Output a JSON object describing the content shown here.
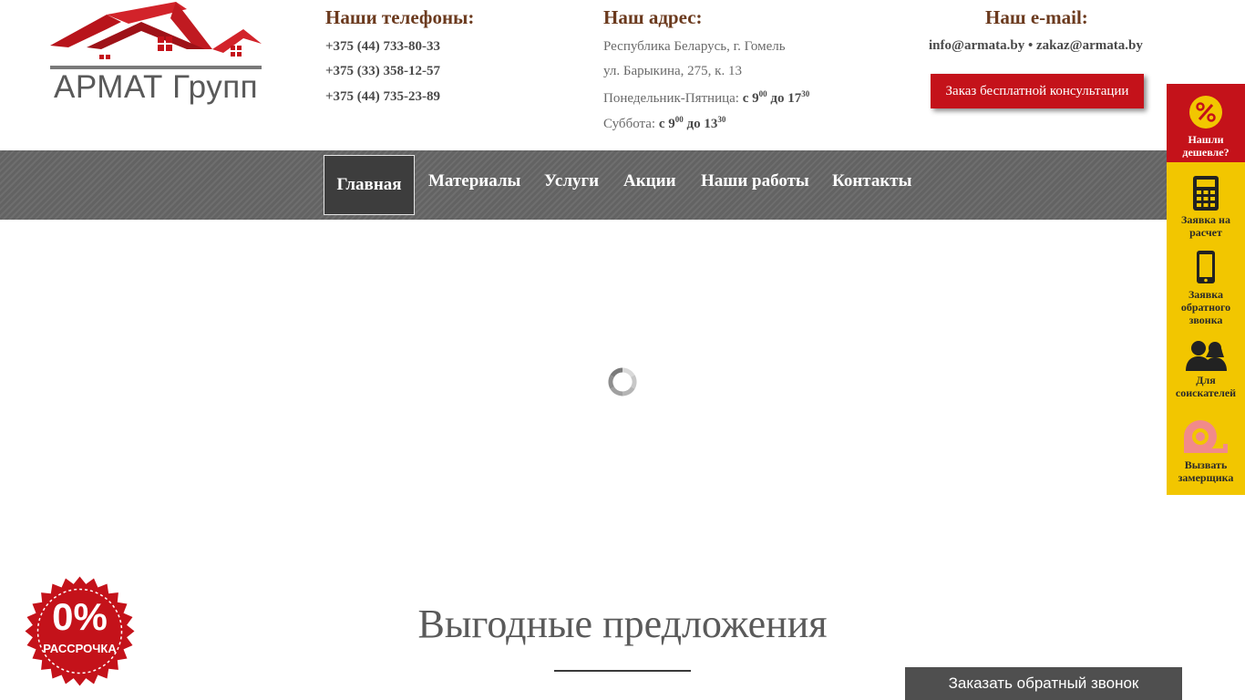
{
  "brand": {
    "logo_text": "АРМАТ Групп"
  },
  "contacts": {
    "phones_title": "Наши телефоны:",
    "phones": [
      "+375 (44) 733-80-33",
      "+375 (33) 358-12-57",
      "+375 (44) 735-23-89"
    ],
    "address_title": "Наш адрес:",
    "address_line1": "Республика Беларусь, г. Гомель",
    "address_line2": "ул. Барыкина, 275, к. 13",
    "weekdays_label": "Понедельник-Пятница:",
    "weekdays_from": "с 9",
    "weekdays_from_min": "00",
    "weekdays_to": "до 17",
    "weekdays_to_min": "30",
    "saturday_label": "Суббота:",
    "saturday_from": "с 9",
    "saturday_from_min": "00",
    "saturday_to": "до 13",
    "saturday_to_min": "30",
    "email_title": "Наш e-mail:",
    "email1": "info@armata.by",
    "email_sep": "•",
    "email2": "zakaz@armata.by",
    "consult_button": "Заказ бесплатной консультации"
  },
  "nav": {
    "items": [
      {
        "label": "Главная",
        "active": true
      },
      {
        "label": "Материалы"
      },
      {
        "label": "Услуги"
      },
      {
        "label": "Акции"
      },
      {
        "label": "Наши работы"
      },
      {
        "label": "Контакты"
      }
    ]
  },
  "sidebar": {
    "items": [
      {
        "label": "Нашли дешевле?",
        "icon": "percent-icon"
      },
      {
        "label": "Заявка на расчет",
        "icon": "calculator-icon"
      },
      {
        "label": "Заявка обратного звонка",
        "icon": "phone-icon"
      },
      {
        "label": "Для соискателей",
        "icon": "people-icon"
      },
      {
        "label": "Вызвать замерщика",
        "icon": "tape-measure-icon"
      }
    ]
  },
  "main": {
    "section_title": "Выгодные предложения",
    "badge_big": "0%",
    "badge_small": "РАССРОЧКА"
  },
  "callback": {
    "label": "Заказать обратный звонок"
  },
  "colors": {
    "brand_red": "#c4121a",
    "sidebar_yellow": "#f2c600",
    "nav_gray": "#636363",
    "title_brown": "#6b3a1e"
  }
}
